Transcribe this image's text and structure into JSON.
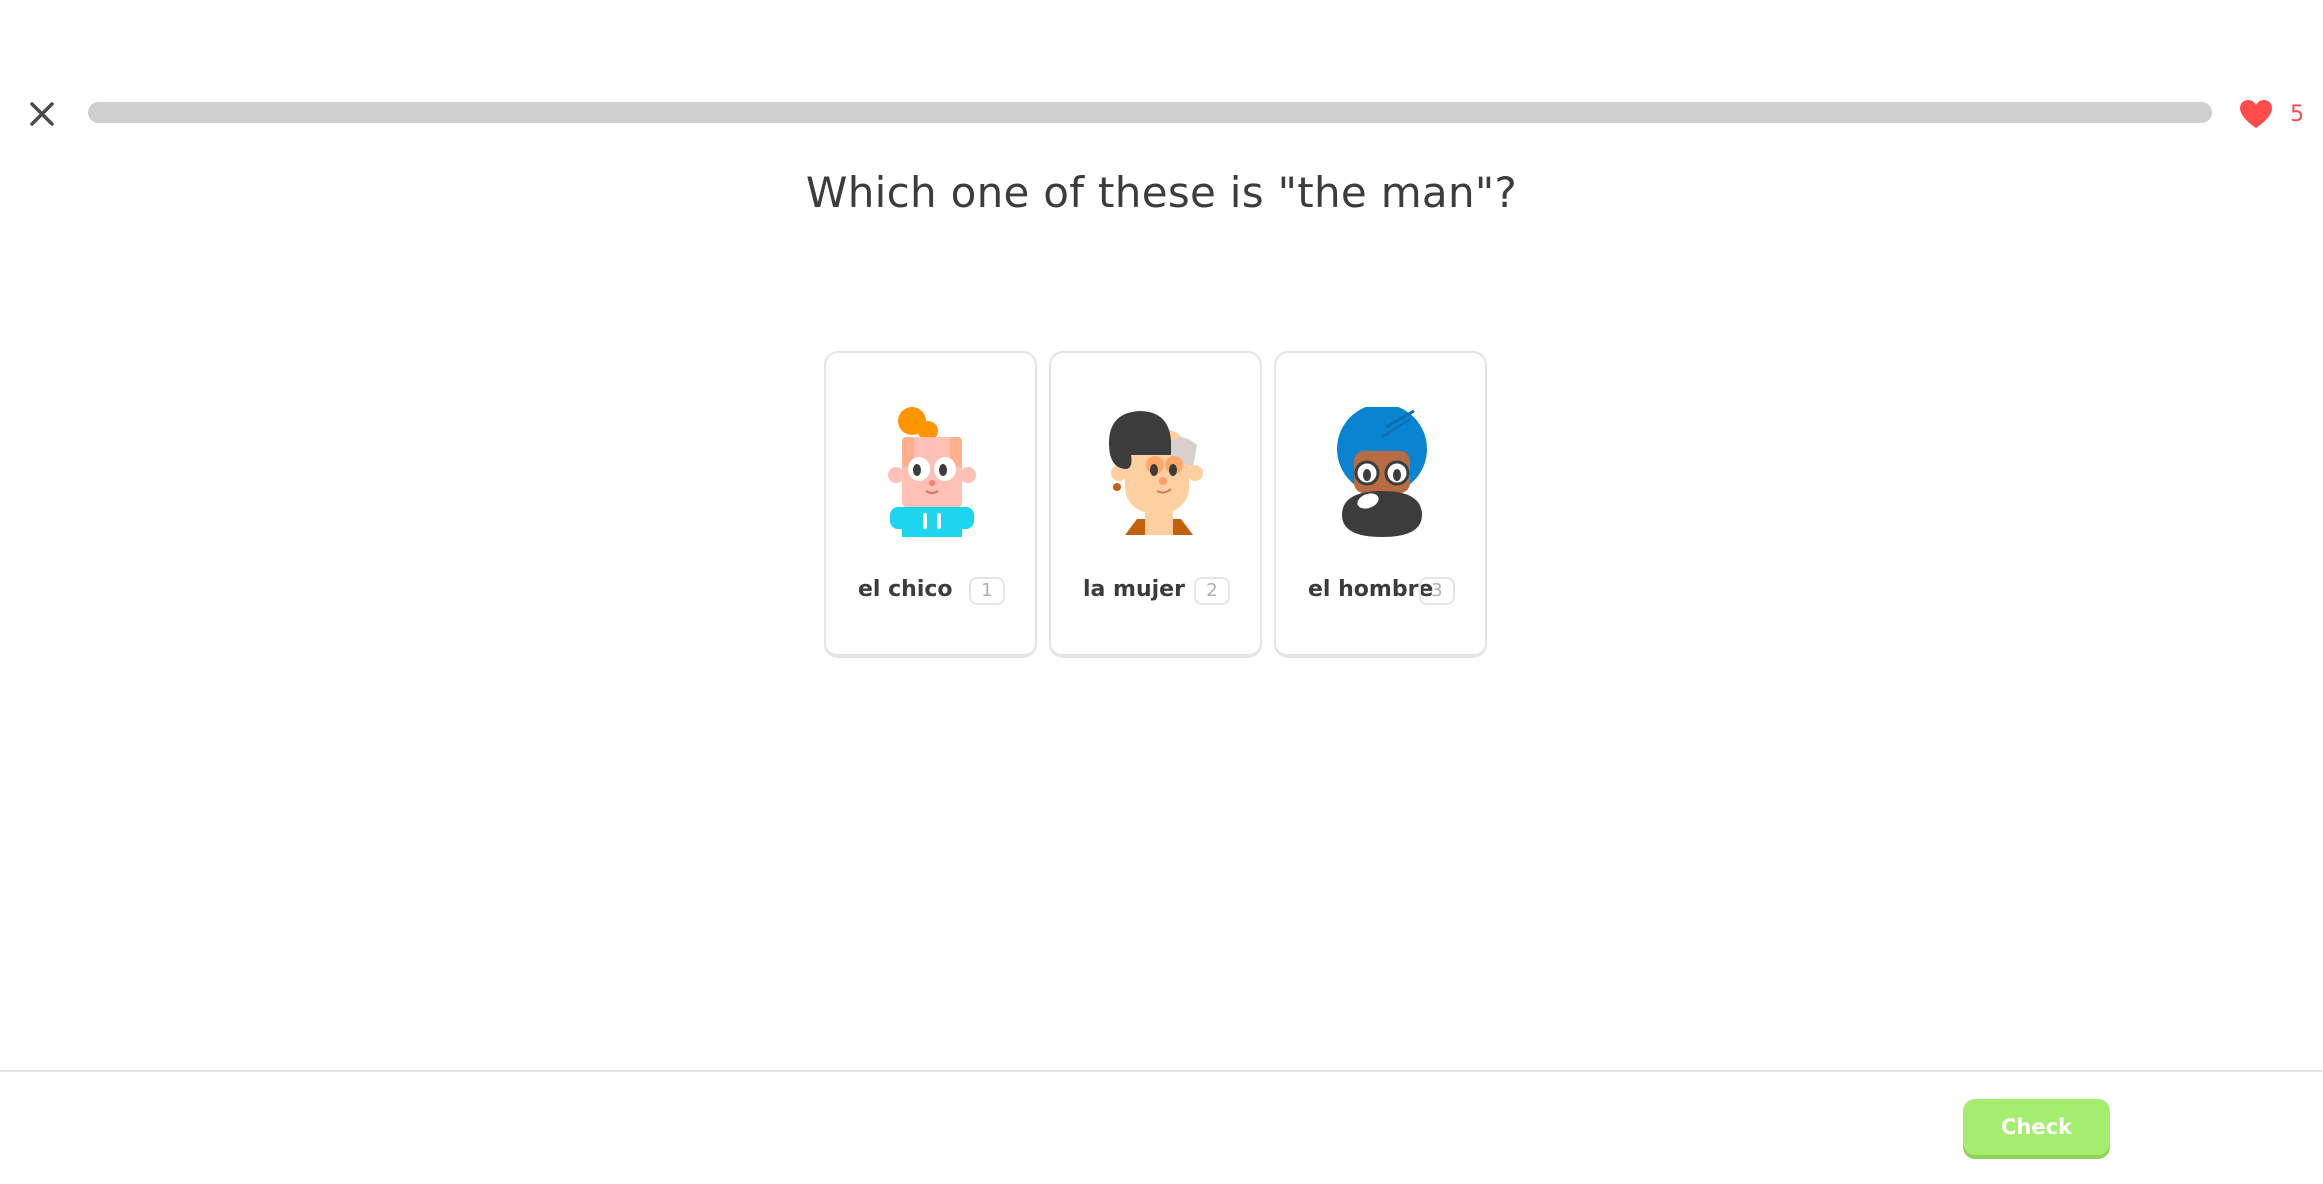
{
  "header": {
    "close_icon": "close-icon",
    "progress": 0,
    "progress_color": "#58cc02",
    "track_color": "#cfcfcf",
    "hearts": {
      "icon": "heart-icon",
      "count": "5",
      "color": "#ff4b4b"
    }
  },
  "question": {
    "text": "Which one of these is \"the man\"?"
  },
  "choices": [
    {
      "label": "el chico",
      "key": "1",
      "illustration": "boy-illustration"
    },
    {
      "label": "la mujer",
      "key": "2",
      "illustration": "woman-illustration"
    },
    {
      "label": "el hombre",
      "key": "3",
      "illustration": "man-illustration"
    }
  ],
  "footer": {
    "check_label": "Check",
    "check_color": "#a5ed6e"
  }
}
